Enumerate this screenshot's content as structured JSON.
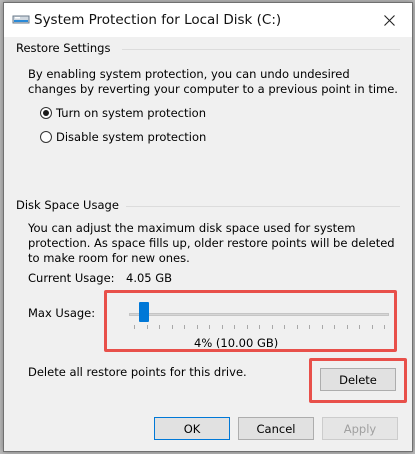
{
  "window": {
    "title": "System Protection for Local Disk (C:)"
  },
  "restore_settings": {
    "group_title": "Restore Settings",
    "description": "By enabling system protection, you can undo undesired changes by reverting your computer to a previous point in time.",
    "options": [
      {
        "label": "Turn on system protection",
        "checked": true
      },
      {
        "label": "Disable system protection",
        "checked": false
      }
    ]
  },
  "disk_space": {
    "group_title": "Disk Space Usage",
    "description": "You can adjust the maximum disk space used for system protection. As space fills up, older restore points will be deleted to make room for new ones.",
    "current_usage_label": "Current Usage:",
    "current_usage_value": "4.05 GB",
    "max_usage_label": "Max Usage:",
    "max_usage_percent": 4,
    "max_usage_value": "4% (10.00 GB)",
    "delete_description": "Delete all restore points for this drive.",
    "delete_label": "Delete"
  },
  "footer": {
    "ok_label": "OK",
    "cancel_label": "Cancel",
    "apply_label": "Apply"
  },
  "colors": {
    "accent": "#0078d7",
    "highlight": "#e8504a"
  }
}
